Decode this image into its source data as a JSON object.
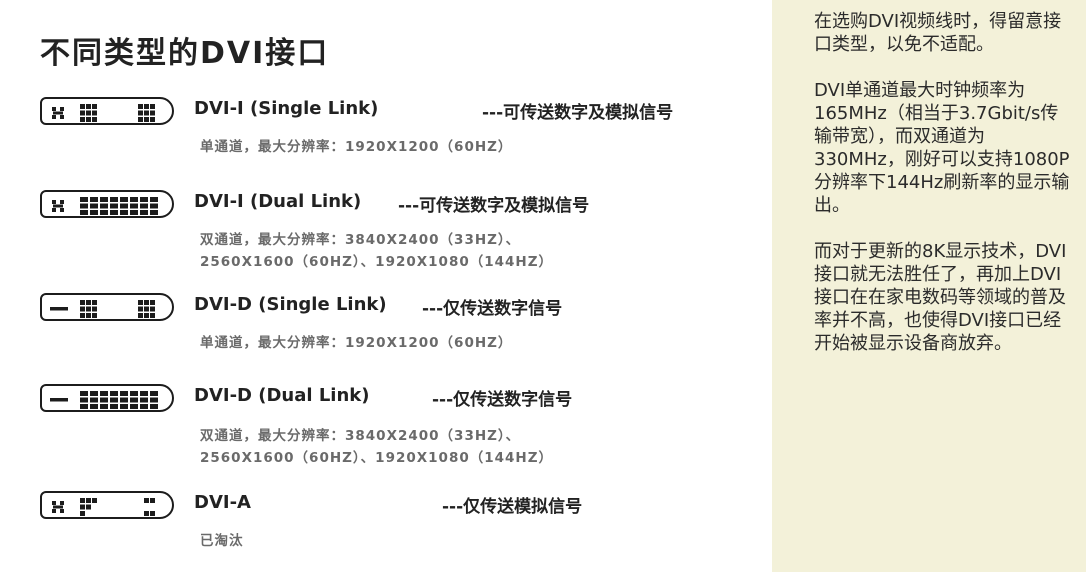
{
  "title": "不同类型的DVI接口",
  "connectors": [
    {
      "name": "DVI-I  (Single Link)",
      "desc": "---可传送数字及模拟信号",
      "spec": [
        "单通道，最大分辨率：1920X1200（60HZ）"
      ],
      "icon": "dvi-i-single-link-connector-icon"
    },
    {
      "name": "DVI-I  (Dual Link)",
      "desc": "---可传送数字及模拟信号",
      "spec": [
        "双通道，最大分辨率：3840X2400（33HZ）、",
        "2560X1600（60HZ）、1920X1080（144HZ）"
      ],
      "icon": "dvi-i-dual-link-connector-icon"
    },
    {
      "name": "DVI-D  (Single Link)",
      "desc": "---仅传送数字信号",
      "spec": [
        "单通道，最大分辨率：1920X1200（60HZ）"
      ],
      "icon": "dvi-d-single-link-connector-icon"
    },
    {
      "name": "DVI-D  (Dual Link)",
      "desc": "---仅传送数字信号",
      "spec": [
        "双通道，最大分辨率：3840X2400（33HZ）、",
        "2560X1600（60HZ）、1920X1080（144HZ）"
      ],
      "icon": "dvi-d-dual-link-connector-icon"
    },
    {
      "name": "DVI-A",
      "desc": "---仅传送模拟信号",
      "spec": [
        "已淘汰"
      ],
      "icon": "dvi-a-connector-icon"
    }
  ],
  "sidebar": {
    "paragraphs": [
      "在选购DVI视频线时，得留意接口类型，以免不适配。",
      "DVI单通道最大时钟频率为165MHz（相当于3.7Gbit/s传输带宽），而双通道为330MHz，刚好可以支持1080P分辨率下144Hz刷新率的显示输出。",
      "而对于更新的8K显示技术，DVI接口就无法胜任了，再加上DVI接口在在家电数码等领域的普及率并不高，也使得DVI接口已经开始被显示设备商放弃。"
    ]
  },
  "colors": {
    "sidebar_bg": "#f3f1d9",
    "text_dark": "#222222",
    "text_gray": "#6a6a6a"
  }
}
